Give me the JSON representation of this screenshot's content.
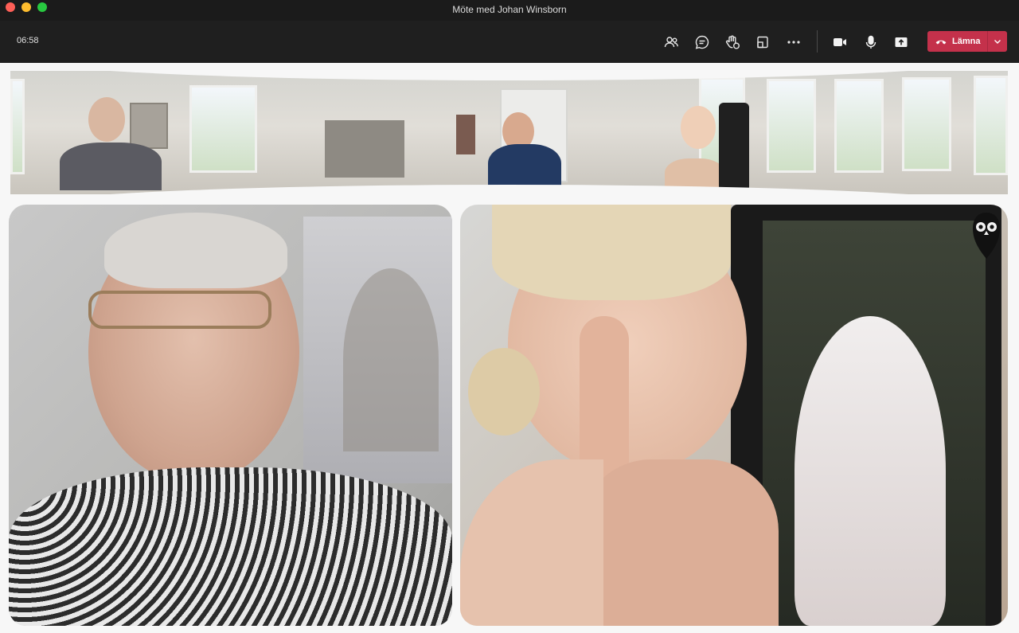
{
  "window": {
    "title": "Möte med Johan Winsborn"
  },
  "toolbar": {
    "timer": "06:58",
    "icons": [
      "people-icon",
      "chat-icon",
      "reactions-icon",
      "share-tray-icon",
      "more-icon",
      "camera-icon",
      "microphone-icon",
      "share-screen-icon"
    ],
    "leave_label": "Lämna"
  },
  "colors": {
    "leave": "#c4314b",
    "toolbar_bg": "#1f1f1f",
    "stage_bg": "#f7f7f7"
  },
  "video": {
    "panorama": "room-panorama-feed",
    "tiles": [
      "participant-video-left",
      "participant-video-right"
    ],
    "overlay_icon": "owl-logo-icon"
  }
}
